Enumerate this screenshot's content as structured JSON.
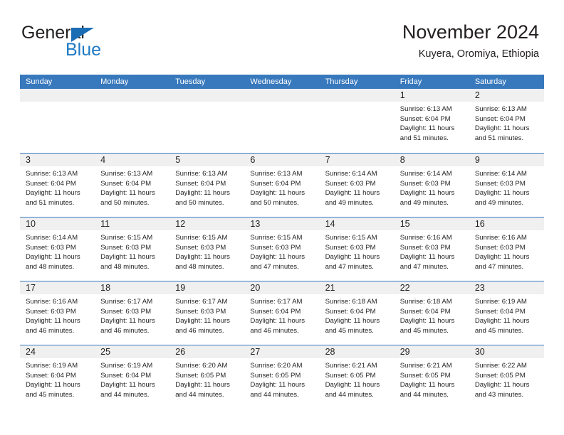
{
  "logo": {
    "word_top": "General",
    "word_bottom": "Blue",
    "triangle_icon": "triangle-icon",
    "brand_blue": "#1f7ac4"
  },
  "header": {
    "title": "November 2024",
    "subtitle": "Kuyera, Oromiya, Ethiopia"
  },
  "theme": {
    "header_blue": "#3879bd",
    "day_band_gray": "#f0f0f0",
    "text_dark": "#231f20"
  },
  "weekday_headers": [
    "Sunday",
    "Monday",
    "Tuesday",
    "Wednesday",
    "Thursday",
    "Friday",
    "Saturday"
  ],
  "weeks": [
    [
      {
        "day": "",
        "empty": true
      },
      {
        "day": "",
        "empty": true
      },
      {
        "day": "",
        "empty": true
      },
      {
        "day": "",
        "empty": true
      },
      {
        "day": "",
        "empty": true
      },
      {
        "day": "1",
        "sunrise": "Sunrise: 6:13 AM",
        "sunset": "Sunset: 6:04 PM",
        "daylight1": "Daylight: 11 hours",
        "daylight2": "and 51 minutes."
      },
      {
        "day": "2",
        "sunrise": "Sunrise: 6:13 AM",
        "sunset": "Sunset: 6:04 PM",
        "daylight1": "Daylight: 11 hours",
        "daylight2": "and 51 minutes."
      }
    ],
    [
      {
        "day": "3",
        "sunrise": "Sunrise: 6:13 AM",
        "sunset": "Sunset: 6:04 PM",
        "daylight1": "Daylight: 11 hours",
        "daylight2": "and 51 minutes."
      },
      {
        "day": "4",
        "sunrise": "Sunrise: 6:13 AM",
        "sunset": "Sunset: 6:04 PM",
        "daylight1": "Daylight: 11 hours",
        "daylight2": "and 50 minutes."
      },
      {
        "day": "5",
        "sunrise": "Sunrise: 6:13 AM",
        "sunset": "Sunset: 6:04 PM",
        "daylight1": "Daylight: 11 hours",
        "daylight2": "and 50 minutes."
      },
      {
        "day": "6",
        "sunrise": "Sunrise: 6:13 AM",
        "sunset": "Sunset: 6:04 PM",
        "daylight1": "Daylight: 11 hours",
        "daylight2": "and 50 minutes."
      },
      {
        "day": "7",
        "sunrise": "Sunrise: 6:14 AM",
        "sunset": "Sunset: 6:03 PM",
        "daylight1": "Daylight: 11 hours",
        "daylight2": "and 49 minutes."
      },
      {
        "day": "8",
        "sunrise": "Sunrise: 6:14 AM",
        "sunset": "Sunset: 6:03 PM",
        "daylight1": "Daylight: 11 hours",
        "daylight2": "and 49 minutes."
      },
      {
        "day": "9",
        "sunrise": "Sunrise: 6:14 AM",
        "sunset": "Sunset: 6:03 PM",
        "daylight1": "Daylight: 11 hours",
        "daylight2": "and 49 minutes."
      }
    ],
    [
      {
        "day": "10",
        "sunrise": "Sunrise: 6:14 AM",
        "sunset": "Sunset: 6:03 PM",
        "daylight1": "Daylight: 11 hours",
        "daylight2": "and 48 minutes."
      },
      {
        "day": "11",
        "sunrise": "Sunrise: 6:15 AM",
        "sunset": "Sunset: 6:03 PM",
        "daylight1": "Daylight: 11 hours",
        "daylight2": "and 48 minutes."
      },
      {
        "day": "12",
        "sunrise": "Sunrise: 6:15 AM",
        "sunset": "Sunset: 6:03 PM",
        "daylight1": "Daylight: 11 hours",
        "daylight2": "and 48 minutes."
      },
      {
        "day": "13",
        "sunrise": "Sunrise: 6:15 AM",
        "sunset": "Sunset: 6:03 PM",
        "daylight1": "Daylight: 11 hours",
        "daylight2": "and 47 minutes."
      },
      {
        "day": "14",
        "sunrise": "Sunrise: 6:15 AM",
        "sunset": "Sunset: 6:03 PM",
        "daylight1": "Daylight: 11 hours",
        "daylight2": "and 47 minutes."
      },
      {
        "day": "15",
        "sunrise": "Sunrise: 6:16 AM",
        "sunset": "Sunset: 6:03 PM",
        "daylight1": "Daylight: 11 hours",
        "daylight2": "and 47 minutes."
      },
      {
        "day": "16",
        "sunrise": "Sunrise: 6:16 AM",
        "sunset": "Sunset: 6:03 PM",
        "daylight1": "Daylight: 11 hours",
        "daylight2": "and 47 minutes."
      }
    ],
    [
      {
        "day": "17",
        "sunrise": "Sunrise: 6:16 AM",
        "sunset": "Sunset: 6:03 PM",
        "daylight1": "Daylight: 11 hours",
        "daylight2": "and 46 minutes."
      },
      {
        "day": "18",
        "sunrise": "Sunrise: 6:17 AM",
        "sunset": "Sunset: 6:03 PM",
        "daylight1": "Daylight: 11 hours",
        "daylight2": "and 46 minutes."
      },
      {
        "day": "19",
        "sunrise": "Sunrise: 6:17 AM",
        "sunset": "Sunset: 6:03 PM",
        "daylight1": "Daylight: 11 hours",
        "daylight2": "and 46 minutes."
      },
      {
        "day": "20",
        "sunrise": "Sunrise: 6:17 AM",
        "sunset": "Sunset: 6:04 PM",
        "daylight1": "Daylight: 11 hours",
        "daylight2": "and 46 minutes."
      },
      {
        "day": "21",
        "sunrise": "Sunrise: 6:18 AM",
        "sunset": "Sunset: 6:04 PM",
        "daylight1": "Daylight: 11 hours",
        "daylight2": "and 45 minutes."
      },
      {
        "day": "22",
        "sunrise": "Sunrise: 6:18 AM",
        "sunset": "Sunset: 6:04 PM",
        "daylight1": "Daylight: 11 hours",
        "daylight2": "and 45 minutes."
      },
      {
        "day": "23",
        "sunrise": "Sunrise: 6:19 AM",
        "sunset": "Sunset: 6:04 PM",
        "daylight1": "Daylight: 11 hours",
        "daylight2": "and 45 minutes."
      }
    ],
    [
      {
        "day": "24",
        "sunrise": "Sunrise: 6:19 AM",
        "sunset": "Sunset: 6:04 PM",
        "daylight1": "Daylight: 11 hours",
        "daylight2": "and 45 minutes."
      },
      {
        "day": "25",
        "sunrise": "Sunrise: 6:19 AM",
        "sunset": "Sunset: 6:04 PM",
        "daylight1": "Daylight: 11 hours",
        "daylight2": "and 44 minutes."
      },
      {
        "day": "26",
        "sunrise": "Sunrise: 6:20 AM",
        "sunset": "Sunset: 6:05 PM",
        "daylight1": "Daylight: 11 hours",
        "daylight2": "and 44 minutes."
      },
      {
        "day": "27",
        "sunrise": "Sunrise: 6:20 AM",
        "sunset": "Sunset: 6:05 PM",
        "daylight1": "Daylight: 11 hours",
        "daylight2": "and 44 minutes."
      },
      {
        "day": "28",
        "sunrise": "Sunrise: 6:21 AM",
        "sunset": "Sunset: 6:05 PM",
        "daylight1": "Daylight: 11 hours",
        "daylight2": "and 44 minutes."
      },
      {
        "day": "29",
        "sunrise": "Sunrise: 6:21 AM",
        "sunset": "Sunset: 6:05 PM",
        "daylight1": "Daylight: 11 hours",
        "daylight2": "and 44 minutes."
      },
      {
        "day": "30",
        "sunrise": "Sunrise: 6:22 AM",
        "sunset": "Sunset: 6:05 PM",
        "daylight1": "Daylight: 11 hours",
        "daylight2": "and 43 minutes."
      }
    ]
  ]
}
